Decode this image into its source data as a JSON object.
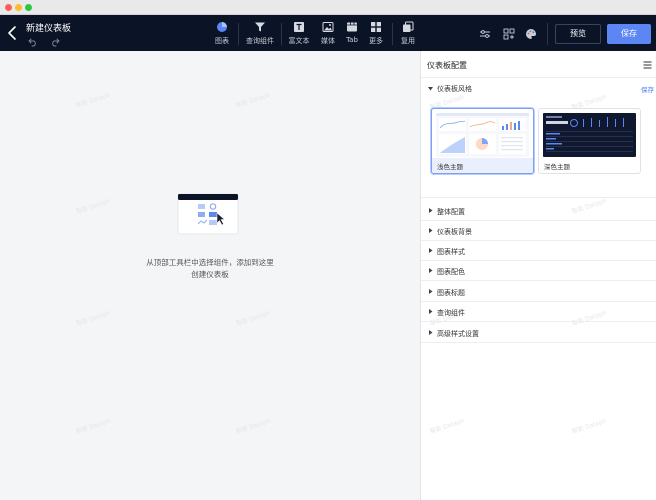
{
  "window": {
    "traffic_lights": [
      "close",
      "minimize",
      "zoom"
    ]
  },
  "header": {
    "doc_title": "新建仪表板",
    "back_icon": "chevron-left-icon",
    "undo_icon": "undo-icon",
    "redo_icon": "redo-icon"
  },
  "toolbar": {
    "tools": [
      {
        "id": "chart",
        "label": "图表",
        "icon": "pie-chart-icon",
        "active": true
      },
      {
        "id": "query",
        "label": "查询组件",
        "icon": "filter-icon"
      },
      {
        "id": "richtext",
        "label": "富文本",
        "icon": "text-icon"
      },
      {
        "id": "media",
        "label": "媒体",
        "icon": "image-icon"
      },
      {
        "id": "tab",
        "label": "Tab",
        "icon": "tab-icon"
      },
      {
        "id": "more",
        "label": "更多",
        "icon": "grid-icon"
      },
      {
        "id": "reuse",
        "label": "复用",
        "icon": "copy-icon"
      }
    ],
    "right_icons": [
      "sliders-icon",
      "layout-icon",
      "palette-icon"
    ],
    "preview_label": "预览",
    "save_label": "保存",
    "accent_color": "#5b86f4"
  },
  "canvas": {
    "empty_line1": "从顶部工具栏中选择组件，添加到这里",
    "empty_line2": "创建仪表板"
  },
  "panel": {
    "title": "仪表板配置",
    "menu_icon": "hamburger-icon",
    "open_section": {
      "label": "仪表板风格",
      "save_label": "保存",
      "themes": [
        {
          "name": "浅色主题",
          "selected": true
        },
        {
          "name": "深色主题",
          "selected": false
        }
      ]
    },
    "sections": [
      {
        "label": "整体配置"
      },
      {
        "label": "仪表板背景"
      },
      {
        "label": "图表样式"
      },
      {
        "label": "图表配色"
      },
      {
        "label": "图表标题"
      },
      {
        "label": "查询组件"
      },
      {
        "label": "高级样式设置"
      }
    ]
  }
}
